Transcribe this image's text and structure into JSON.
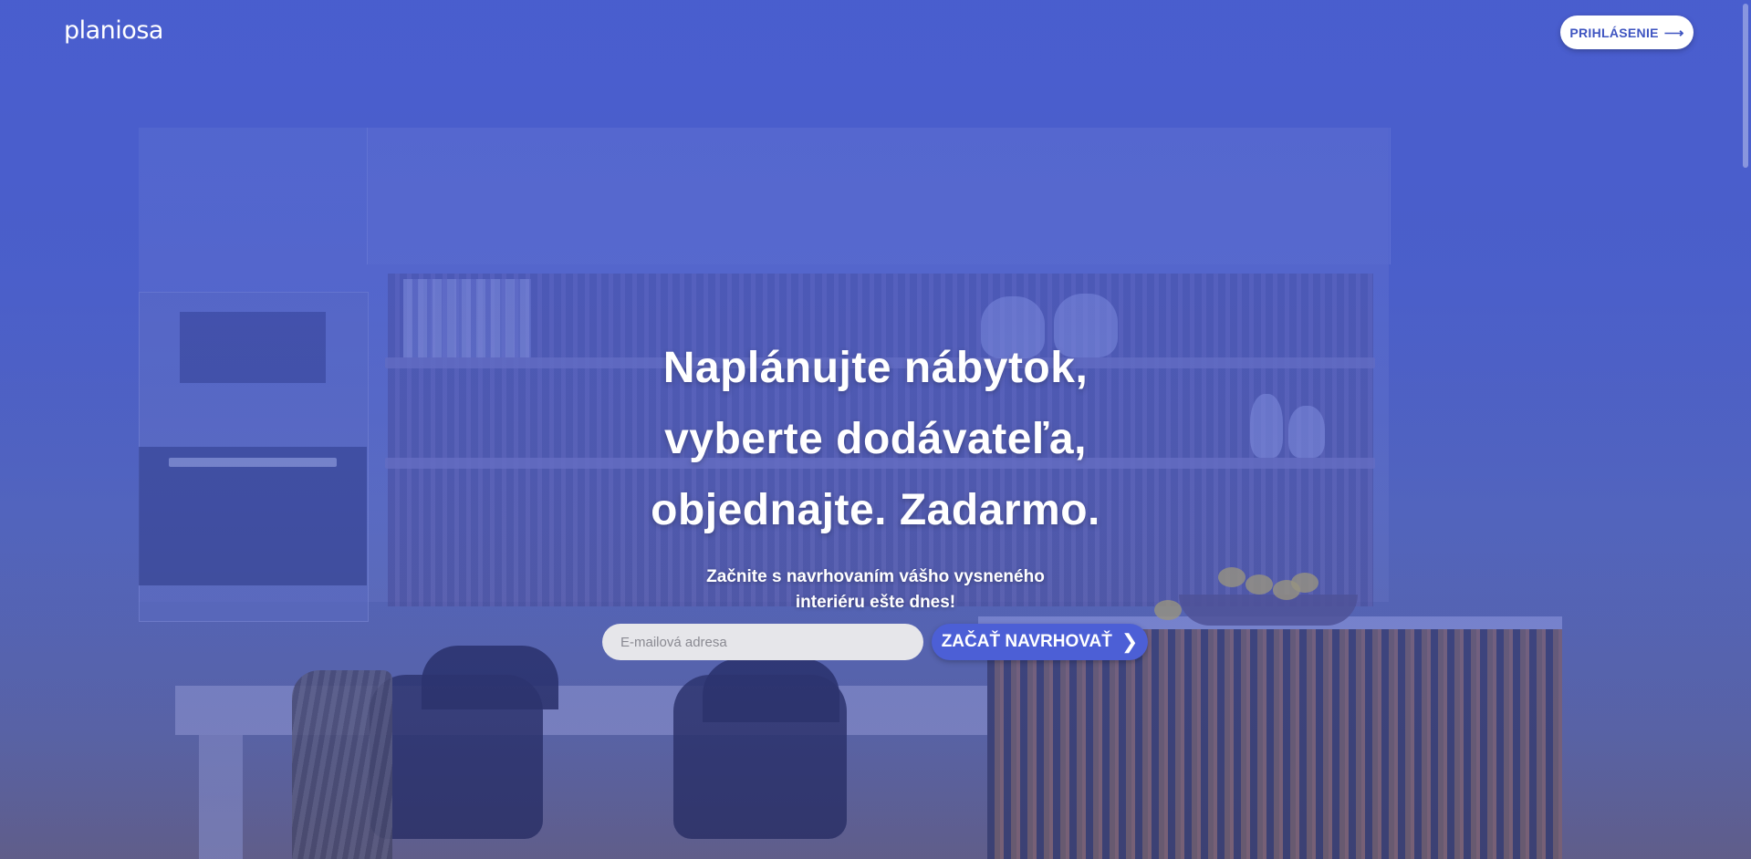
{
  "header": {
    "logo_text": "planiosa",
    "login_label": "PRIHLÁSENIE",
    "login_icon": "arrow-right-icon"
  },
  "hero": {
    "title_line1": "Naplánujte nábytok,",
    "title_line2": "vyberte dodávateľa,",
    "title_line3": "objednajte. Zadarmo.",
    "subtitle": "Začnite s navrhovaním vášho vysneného interiéru ešte dnes!"
  },
  "signup": {
    "email_placeholder": "E-mailová adresa",
    "email_value": "",
    "submit_label": "ZAČAŤ NAVRHOVAŤ",
    "submit_icon": "chevron-right-icon"
  },
  "colors": {
    "overlay": "#485dce",
    "button_primary": "#4c5fd6",
    "button_text": "#3f55c1"
  }
}
